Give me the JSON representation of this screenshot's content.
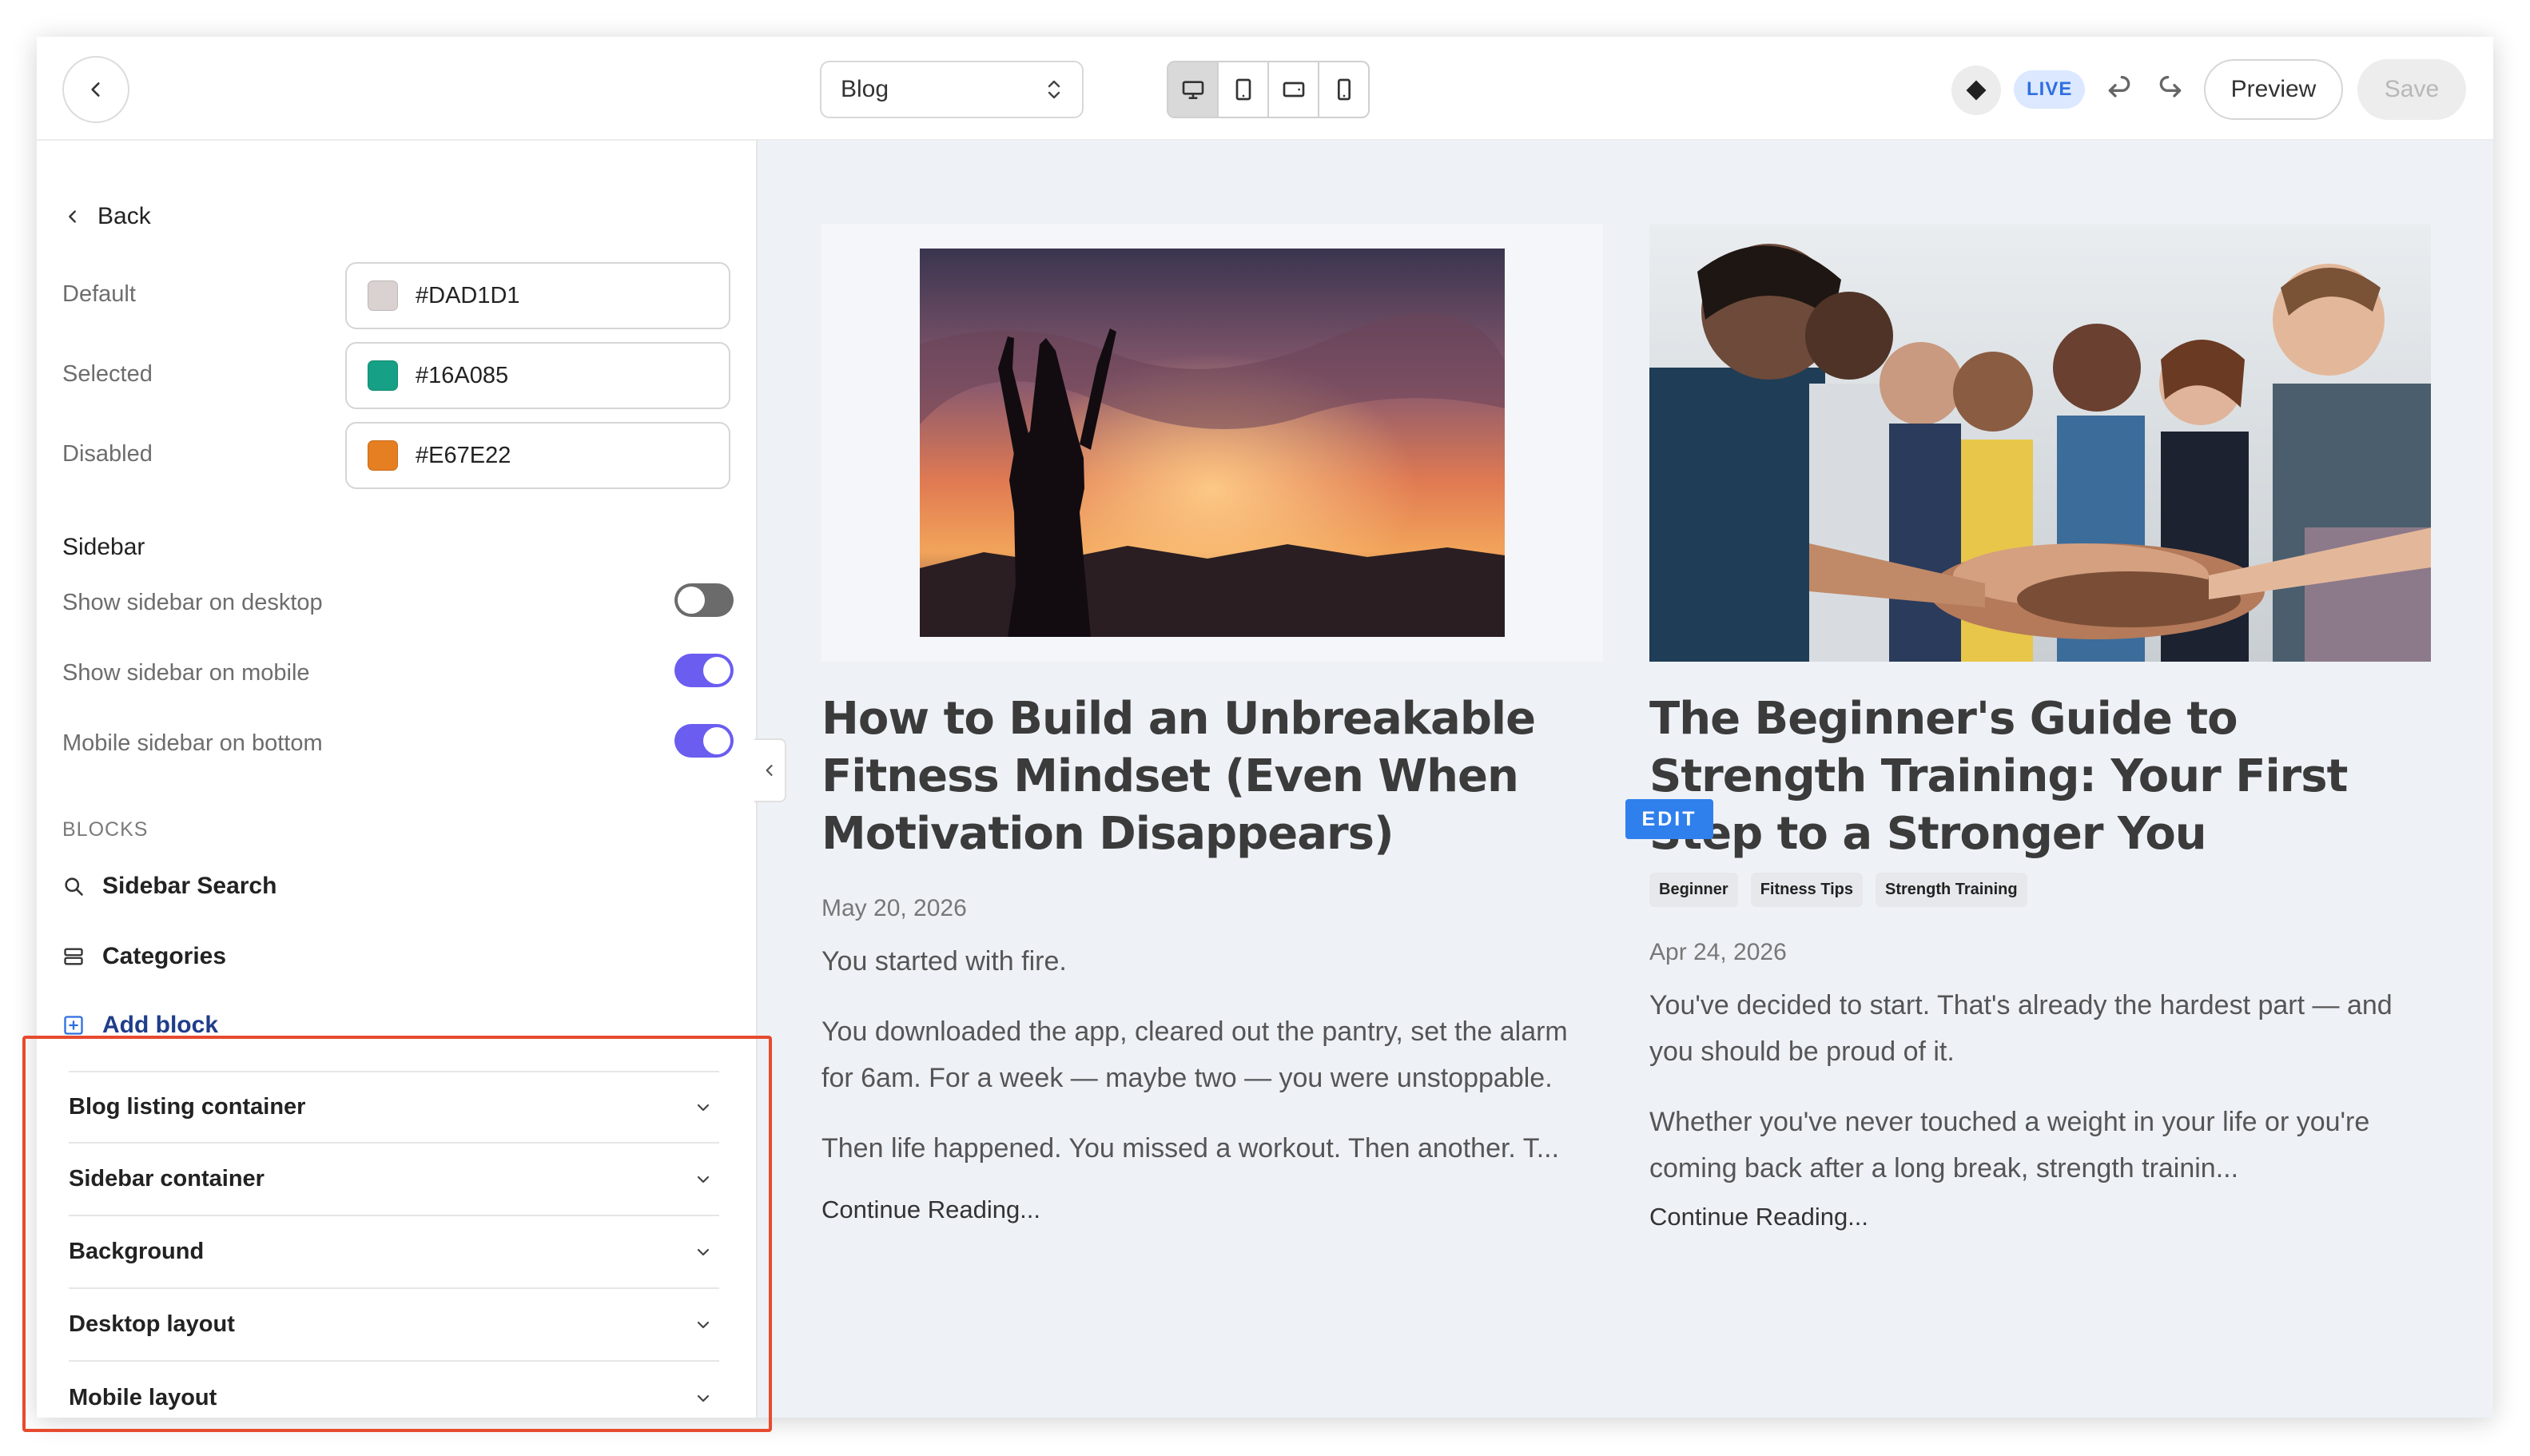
{
  "topbar": {
    "page_select": "Blog",
    "live_badge": "LIVE",
    "preview_label": "Preview",
    "save_label": "Save"
  },
  "panel": {
    "back_label": "Back",
    "colors": [
      {
        "label": "Default",
        "value": "#DAD1D1",
        "swatch": "#DAD1D1"
      },
      {
        "label": "Selected",
        "value": "#16A085",
        "swatch": "#16A085"
      },
      {
        "label": "Disabled",
        "value": "#E67E22",
        "swatch": "#E67E22"
      }
    ],
    "sidebar_title": "Sidebar",
    "toggles": [
      {
        "label": "Show sidebar on desktop",
        "on": false
      },
      {
        "label": "Show sidebar on mobile",
        "on": true
      },
      {
        "label": "Mobile sidebar on bottom",
        "on": true
      }
    ],
    "blocks_heading": "BLOCKS",
    "blocks": [
      {
        "label": "Sidebar Search",
        "icon": "search-icon"
      },
      {
        "label": "Categories",
        "icon": "categories-icon"
      }
    ],
    "add_block_label": "Add block",
    "accordion": [
      "Blog listing container",
      "Sidebar container",
      "Background",
      "Desktop layout",
      "Mobile layout"
    ]
  },
  "posts": [
    {
      "title": "How to Build an Unbreakable Fitness Mindset (Even When Motivation Disappears)",
      "date": "May 20, 2026",
      "paragraphs": [
        "You started with fire.",
        "You downloaded the app, cleared out the pantry, set the alarm for 6am. For a week — maybe two — you were unstoppable.",
        "Then life happened. You missed a workout. Then another. T..."
      ],
      "continue_label": "Continue Reading..."
    },
    {
      "title": "The Beginner's Guide to Strength Training: Your First Step to a Stronger You",
      "tags": [
        "Beginner",
        "Fitness Tips",
        "Strength Training"
      ],
      "date": "Apr 24, 2026",
      "paragraphs": [
        "You've decided to start. That's already the hardest part — and you should be proud of it.",
        "Whether you've never touched a weight in your life or you're coming back after a long break, strength trainin..."
      ],
      "continue_label": "Continue Reading..."
    }
  ],
  "edit_badge": "EDIT",
  "accent_colors": {
    "toggle_on": "#6a5df0",
    "live": "#2f6fe0",
    "edit": "#2f80ed",
    "highlight": "#e64a2e"
  }
}
